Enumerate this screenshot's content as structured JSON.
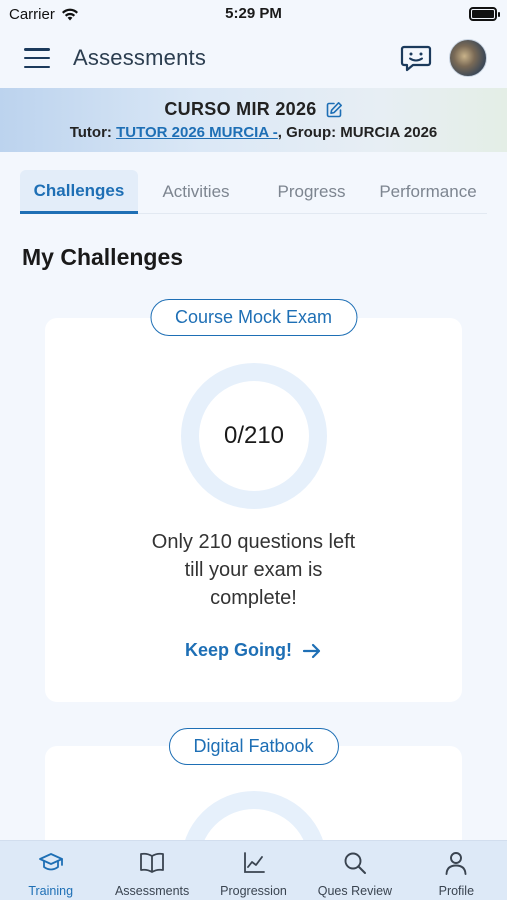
{
  "status_bar": {
    "carrier": "Carrier",
    "time": "5:29 PM",
    "icons": [
      "wifi-icon",
      "battery-icon"
    ]
  },
  "header": {
    "title": "Assessments",
    "icons": [
      "menu-icon",
      "chat-icon",
      "avatar"
    ]
  },
  "course": {
    "name": "CURSO MIR 2026",
    "tutor_label": "Tutor: ",
    "tutor_name": "TUTOR 2026 MURCIA -",
    "group_text": ", Group: MURCIA 2026"
  },
  "tabs": [
    {
      "label": "Challenges",
      "active": true
    },
    {
      "label": "Activities",
      "active": false
    },
    {
      "label": "Progress",
      "active": false
    },
    {
      "label": "Performance",
      "active": false
    }
  ],
  "section_title": "My Challenges",
  "challenges": [
    {
      "title": "Course Mock Exam",
      "progress_text": "0/210",
      "progress": 0,
      "message_lines": [
        "Only 210 questions left",
        "till your exam is",
        "complete!"
      ],
      "action_label": "Keep Going!"
    },
    {
      "title": "Digital Fatbook"
    }
  ],
  "bottom_nav": [
    {
      "label": "Training",
      "icon": "graduation-cap-icon",
      "active": true
    },
    {
      "label": "Assessments",
      "icon": "open-book-icon",
      "active": false
    },
    {
      "label": "Progression",
      "icon": "chart-icon",
      "active": false
    },
    {
      "label": "Ques Review",
      "icon": "search-icon",
      "active": false
    },
    {
      "label": "Profile",
      "icon": "person-icon",
      "active": false
    }
  ],
  "colors": {
    "accent": "#1e6fb5",
    "ring_track": "#e6f0fb",
    "background": "#f3f7fd",
    "nav_background": "#dde9f7"
  }
}
